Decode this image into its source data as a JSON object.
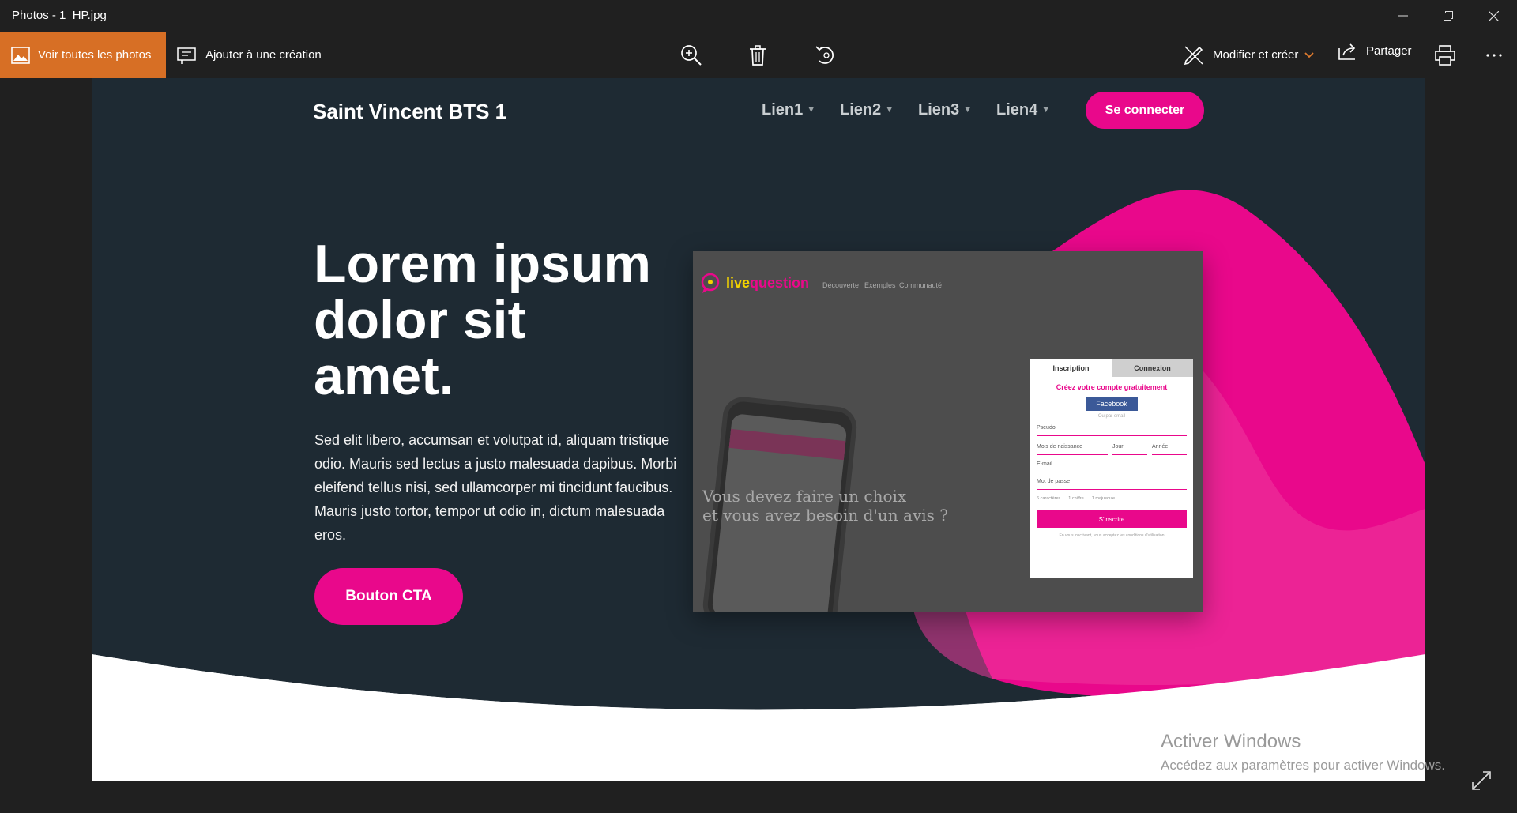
{
  "window": {
    "title": "Photos - 1_HP.jpg"
  },
  "toolbar": {
    "view_all_label": "Voir toutes les photos",
    "add_creation_label": "Ajouter à une création",
    "edit_create_label": "Modifier et créer",
    "share_label": "Partager",
    "icons": [
      "zoom-in-icon",
      "delete-icon",
      "rotate-icon",
      "print-icon",
      "more-icon"
    ]
  },
  "site": {
    "logo": "Saint Vincent BTS 1",
    "nav": [
      "Lien1",
      "Lien2",
      "Lien3",
      "Lien4"
    ],
    "connect_label": "Se connecter",
    "hero_title": "Lorem ipsum dolor sit amet.",
    "hero_text": "Sed elit libero, accumsan et volutpat id, aliquam tristique odio. Mauris sed lectus a justo malesuada dapibus. Morbi eleifend tellus nisi, sed ullamcorper mi tincidunt faucibus. Mauris justo tortor, tempor ut odio in, dictum malesuada eros.",
    "cta_label": "Bouton CTA",
    "colors": {
      "dark": "#1e2a33",
      "accent": "#e9088b"
    }
  },
  "preview": {
    "logo_a": "live",
    "logo_b": "question",
    "nav": [
      "Découverte",
      "Exemples",
      "Communauté"
    ],
    "tagline_1": "Vous devez faire un choix",
    "tagline_2": "et vous avez besoin d'un avis ?",
    "form": {
      "tab_signup": "Inscription",
      "tab_login": "Connexion",
      "heading": "Créez votre compte gratuitement",
      "facebook": "Facebook",
      "or_email": "Ou par email",
      "pseudo": "Pseudo",
      "month": "Mois de naissance",
      "day": "Jour",
      "year": "Année",
      "email": "E-mail",
      "password": "Mot de passe",
      "hint_1": "6 caractères",
      "hint_2": "1 chiffre",
      "hint_3": "1 majuscule",
      "submit": "S'inscrire",
      "legal": "En vous inscrivant, vous acceptez les conditions d'utilisation"
    }
  },
  "watermark": {
    "line1": "Activer Windows",
    "line2": "Accédez aux paramètres pour activer Windows."
  }
}
